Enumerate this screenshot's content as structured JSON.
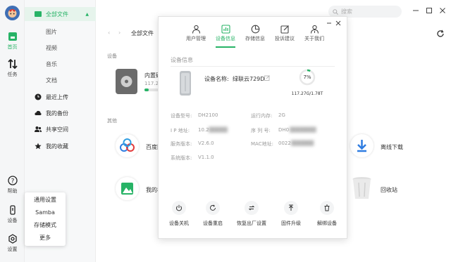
{
  "rail": {
    "home": "首页",
    "tasks": "任务",
    "help": "帮助",
    "device": "设备",
    "settings": "设置"
  },
  "sidenav": {
    "all_files": "全部文件",
    "subs": [
      "图片",
      "视频",
      "音乐",
      "文档"
    ],
    "recent": "最近上传",
    "backup": "我的备份",
    "shared": "共享空间",
    "favorites": "我的收藏"
  },
  "main": {
    "search_placeholder": "搜索",
    "breadcrumb": "全部文件",
    "section_device": "设备",
    "device_name": "内置硬",
    "device_size": "117.27",
    "section_other": "其他",
    "tiles": [
      "百度网",
      "我的相",
      "离线下载",
      "回收站"
    ]
  },
  "popmenu": {
    "items": [
      "通用设置",
      "Samba",
      "存储模式",
      "更多"
    ]
  },
  "dialog": {
    "tabs": [
      "用户管理",
      "设备信息",
      "存储信息",
      "投诉建议",
      "关于我们"
    ],
    "active_tab": 1,
    "section_title": "设备信息",
    "device_name_label": "设备名称:",
    "device_name_value": "绿联云729D",
    "usage_percent": "7%",
    "usage_fraction": 0.07,
    "storage": "117.27G/1.78T",
    "info": {
      "model_label": "设备型号:",
      "model_value": "DH2100",
      "ram_label": "运行内存:",
      "ram_value": "2G",
      "ip_label": "I P 地址:",
      "ip_value": "10.2",
      "serial_label": "序 列 号:",
      "serial_value": "DH0",
      "service_label": "服务版本:",
      "service_value": "V2.6.0",
      "mac_label": "MAC地址:",
      "mac_value": "0022",
      "system_label": "系统版本:",
      "system_value": "V1.1.0"
    },
    "actions": [
      "设备关机",
      "设备重启",
      "恢复出厂设置",
      "固件升级",
      "解绑设备"
    ]
  },
  "colors": {
    "accent": "#27b366",
    "nav_active_bg": "#e6f4ec"
  },
  "icons": {
    "rail": [
      "home-icon",
      "transfer-icon",
      "help-icon",
      "device-icon",
      "settings-icon"
    ],
    "dialog_tabs": [
      "user-icon",
      "device-info-icon",
      "storage-pie-icon",
      "edit-feedback-icon",
      "about-icon"
    ],
    "actions": [
      "power-icon",
      "restart-icon",
      "factory-reset-icon",
      "upload-icon",
      "trash-icon"
    ]
  }
}
